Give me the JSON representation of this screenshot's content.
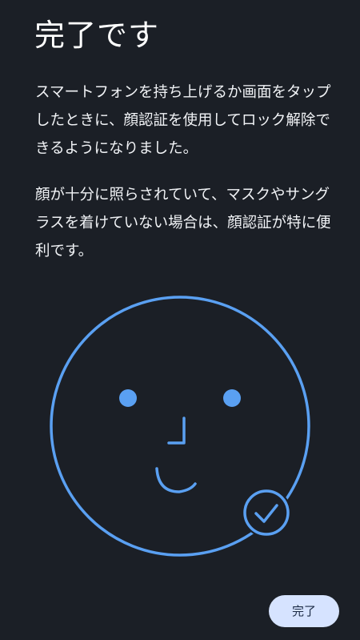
{
  "header": {
    "title": "完了です"
  },
  "content": {
    "paragraph1": "スマートフォンを持ち上げるか画面をタップしたときに、顔認証を使用してロック解除できるようになりました。",
    "paragraph2": "顔が十分に照らされていて、マスクやサングラスを着けていない場合は、顔認証が特に便利です。"
  },
  "illustration": {
    "face_icon": "face-outline-icon",
    "check_icon": "check-circle-icon",
    "accent_color": "#5aa0f2"
  },
  "footer": {
    "done_label": "完了"
  }
}
